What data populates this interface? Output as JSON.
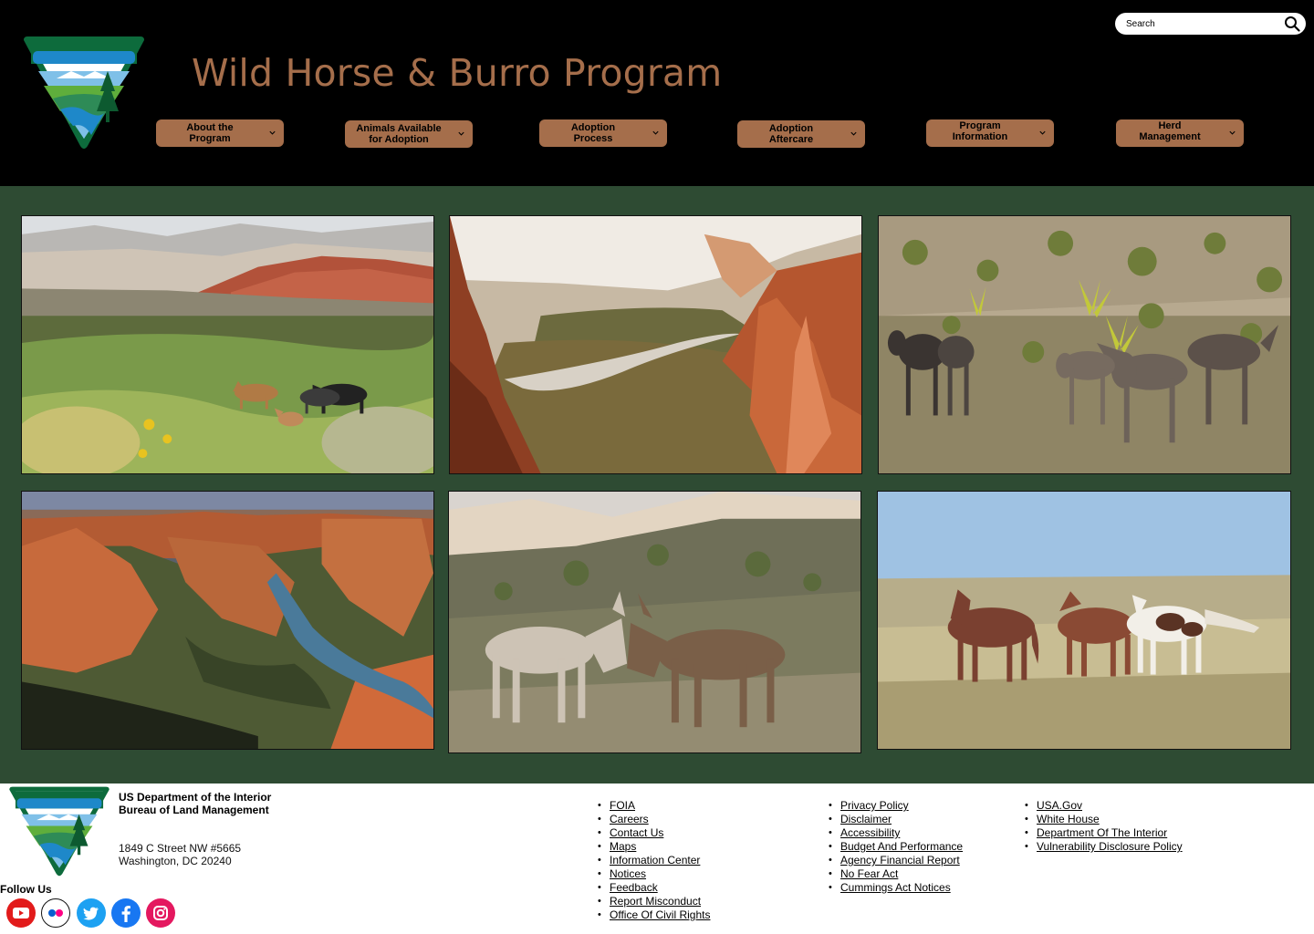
{
  "header": {
    "title": "Wild Horse & Burro Program",
    "search_placeholder": "Search",
    "logo_icon": "blm-logo",
    "nav": [
      {
        "line1": "About the",
        "line2": "Program"
      },
      {
        "line1": "Animals Available",
        "line2": "for Adoption"
      },
      {
        "line1": "Adoption",
        "line2": "Process"
      },
      {
        "line1": "Adoption",
        "line2": "Aftercare"
      },
      {
        "line1": "Program",
        "line2": "Information"
      },
      {
        "line1": "Herd",
        "line2": "Management"
      }
    ]
  },
  "gallery": {
    "background": "#2e4b33",
    "photos": [
      "horses-in-meadow",
      "canyon-road",
      "burros-in-desert",
      "river-canyon",
      "two-burros",
      "horses-on-grassland"
    ]
  },
  "footer": {
    "org_line1": "US Department of the Interior",
    "org_line2": "Bureau of Land Management",
    "address_line1": "1849 C Street NW #5665",
    "address_line2": "Washington, DC 20240",
    "follow_us": "Follow Us",
    "social": [
      "youtube-icon",
      "flickr-icon",
      "twitter-icon",
      "facebook-icon",
      "instagram-icon"
    ],
    "links_col1": [
      "FOIA",
      "Careers",
      "Contact Us",
      "Maps",
      "Information Center",
      "Notices",
      "Feedback",
      "Report Misconduct",
      "Office Of Civil Rights"
    ],
    "links_col2": [
      "Privacy Policy",
      "Disclaimer",
      "Accessibility",
      "Budget And Performance",
      "Agency Financial Report",
      "No Fear Act",
      "Cummings Act Notices"
    ],
    "links_col3": [
      "USA.Gov",
      "White House",
      "Department Of The Interior",
      "Vulnerability Disclosure Policy"
    ]
  },
  "colors": {
    "accent": "#a56e4b",
    "header_bg": "#000000",
    "gallery_bg": "#2e4b33"
  }
}
